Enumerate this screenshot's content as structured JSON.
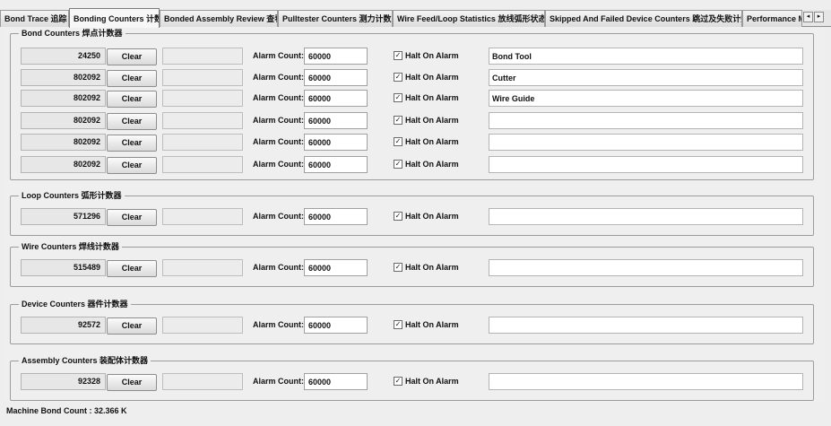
{
  "tabs": [
    {
      "label": "Bond Trace 追踪"
    },
    {
      "label": "Bonding Counters 计数"
    },
    {
      "label": "Bonded Assembly Review 查看"
    },
    {
      "label": "Pulltester Counters 测力计数"
    },
    {
      "label": "Wire Feed/Loop Statistics 放线弧形状态"
    },
    {
      "label": "Skipped And Failed Device Counters 跳过及失败计数"
    },
    {
      "label": "Performance M"
    }
  ],
  "tab_scroll": {
    "left": "◂",
    "right": "▸"
  },
  "common": {
    "clear_label": "Clear",
    "alarm_label": "Alarm Count:",
    "halt_label": "Halt On Alarm",
    "check_mark": "✓"
  },
  "groups": {
    "bond": {
      "title": "Bond Counters 焊点计数器",
      "rows": [
        {
          "count": "24250",
          "alarm": "60000",
          "halt": true,
          "tool": "Bond Tool"
        },
        {
          "count": "802092",
          "alarm": "60000",
          "halt": true,
          "tool": "Cutter"
        },
        {
          "count": "802092",
          "alarm": "60000",
          "halt": true,
          "tool": "Wire Guide"
        },
        {
          "count": "802092",
          "alarm": "60000",
          "halt": true,
          "tool": ""
        },
        {
          "count": "802092",
          "alarm": "60000",
          "halt": true,
          "tool": ""
        },
        {
          "count": "802092",
          "alarm": "60000",
          "halt": true,
          "tool": ""
        }
      ]
    },
    "loop": {
      "title": "Loop Counters 弧形计数器",
      "rows": [
        {
          "count": "571296",
          "alarm": "60000",
          "halt": true,
          "tool": ""
        }
      ]
    },
    "wire": {
      "title": "Wire Counters 焊线计数器",
      "rows": [
        {
          "count": "515489",
          "alarm": "60000",
          "halt": true,
          "tool": ""
        }
      ]
    },
    "device": {
      "title": "Device Counters 器件计数器",
      "rows": [
        {
          "count": "92572",
          "alarm": "60000",
          "halt": true,
          "tool": ""
        }
      ]
    },
    "assembly": {
      "title": "Assembly Counters 装配体计数器",
      "rows": [
        {
          "count": "92328",
          "alarm": "60000",
          "halt": true,
          "tool": ""
        }
      ]
    }
  },
  "footer": {
    "machine_bond_count": "Machine Bond Count : 32.366 K"
  }
}
